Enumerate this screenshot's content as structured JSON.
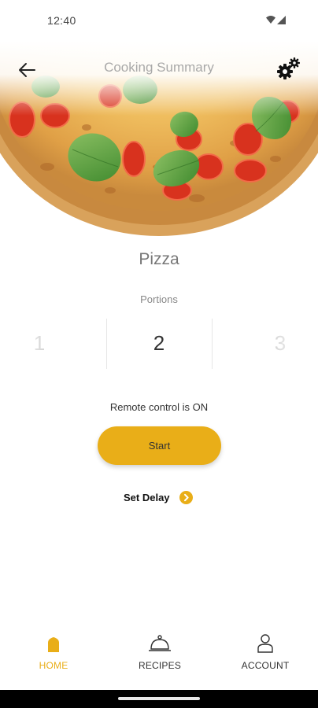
{
  "status_bar": {
    "time": "12:40",
    "icons": [
      "wifi-icon",
      "cellular-signal-icon"
    ]
  },
  "header": {
    "title": "Cooking Summary",
    "back_icon": "arrow-back-icon",
    "settings_icon": "gears-icon"
  },
  "recipe": {
    "name": "Pizza",
    "image": "pizza-image"
  },
  "portions": {
    "label": "Portions",
    "previous": "1",
    "selected": "2",
    "next": "3"
  },
  "remote": {
    "status_text": "Remote control is ON"
  },
  "actions": {
    "start_label": "Start",
    "set_delay_label": "Set Delay",
    "set_delay_icon": "chevron-right-circle-icon"
  },
  "bottom_nav": {
    "items": [
      {
        "label": "HOME",
        "icon": "home-icon",
        "active": true
      },
      {
        "label": "RECIPES",
        "icon": "cloche-icon",
        "active": false
      },
      {
        "label": "ACCOUNT",
        "icon": "person-icon",
        "active": false
      }
    ]
  },
  "colors": {
    "accent": "#e9ae18",
    "title": "#a8a8a8",
    "text": "#333333"
  }
}
